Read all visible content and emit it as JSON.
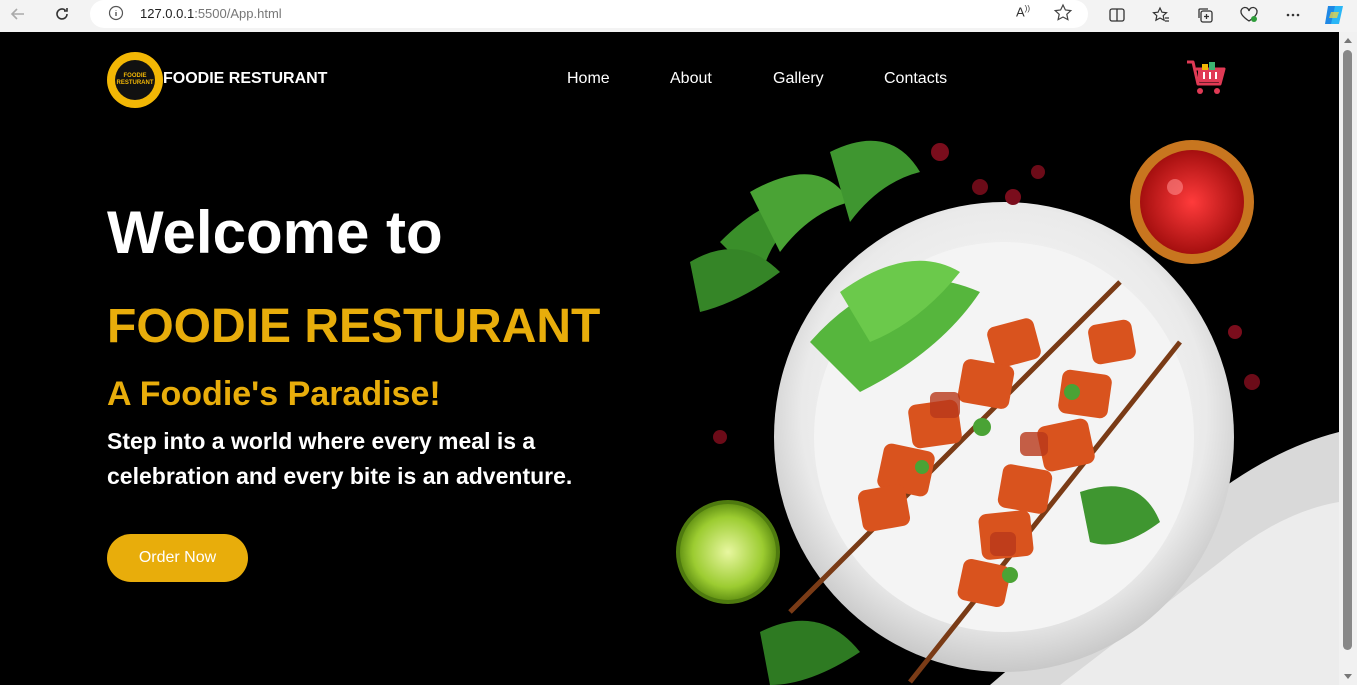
{
  "browser": {
    "url_host": "127.0.0.1",
    "url_rest": ":5500/App.html",
    "read_aloud": "A"
  },
  "header": {
    "logo_text": "FOODIE RESTURANT",
    "brand": "FOODIE RESTURANT",
    "nav": [
      "Home",
      "About",
      "Gallery",
      "Contacts"
    ]
  },
  "hero": {
    "welcome": "Welcome to",
    "name": "FOODIE RESTURANT",
    "tagline": "A Foodie's Paradise!",
    "description": "Step into a world where every meal is a celebration and every bite is an adventure.",
    "button": "Order Now"
  },
  "colors": {
    "accent": "#e8ad0b",
    "background": "#000000",
    "text": "#ffffff"
  },
  "icons": [
    "back-arrow-icon",
    "reload-icon",
    "info-icon",
    "read-aloud-icon",
    "favorite-star-icon",
    "split-screen-icon",
    "favorites-icon",
    "collections-icon",
    "browser-essentials-icon",
    "more-icon",
    "copilot-icon",
    "cart-icon"
  ]
}
